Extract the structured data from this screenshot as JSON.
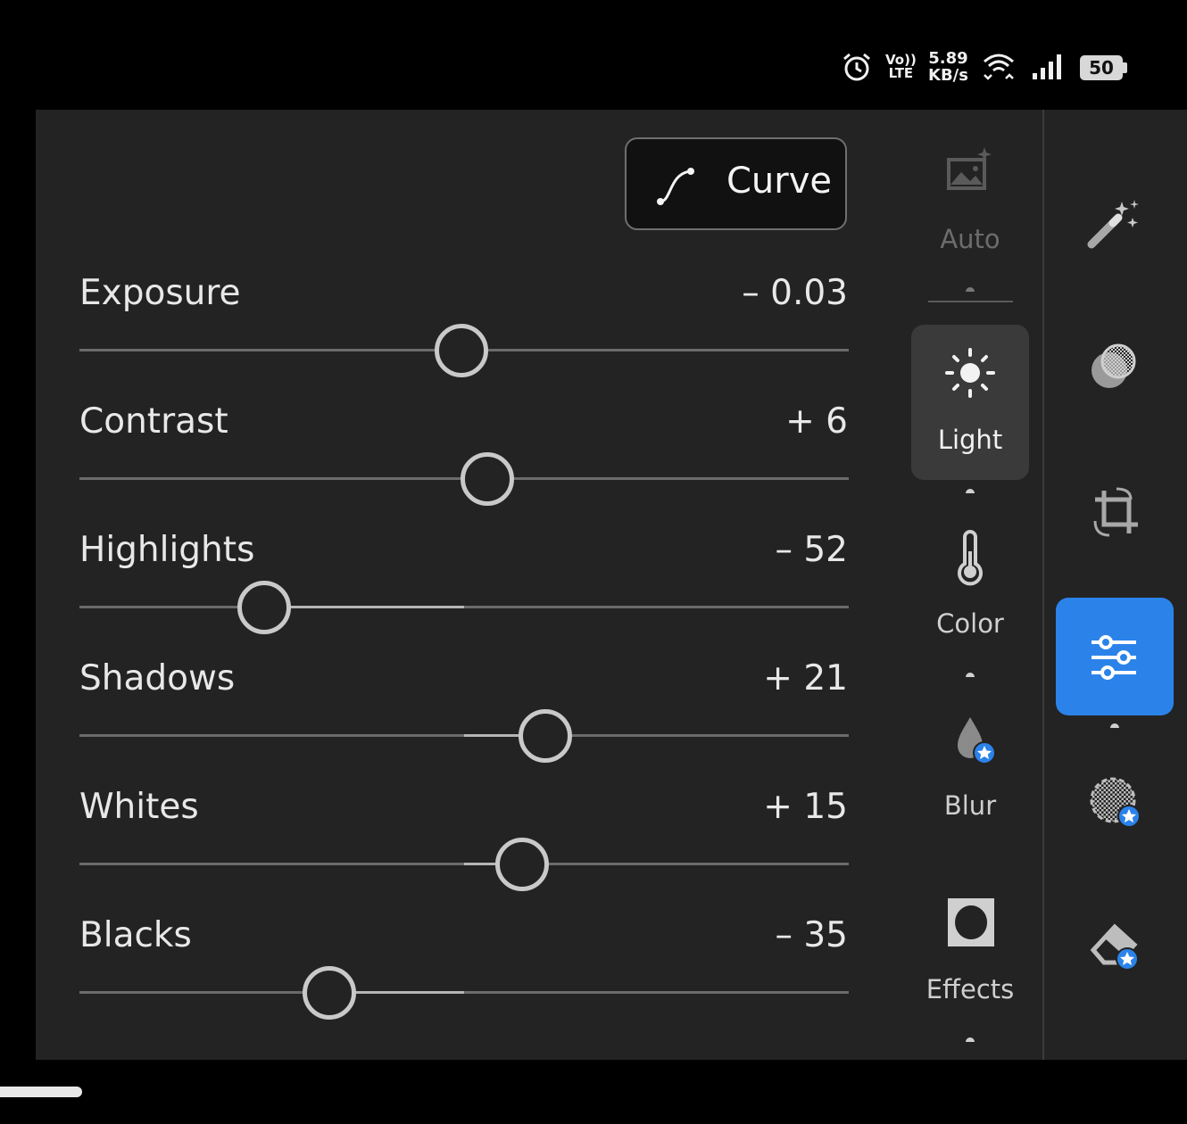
{
  "status_bar": {
    "alarm_icon": "alarm-clock-icon",
    "volte_top": "Vo))",
    "volte_bottom": "LTE",
    "speed_value": "5.89",
    "speed_unit": "KB/s",
    "battery": "50"
  },
  "curve_button": {
    "label": "Curve",
    "icon": "curve-icon"
  },
  "sliders": [
    {
      "label": "Exposure",
      "value": "– 0.03",
      "numeric": -0.03,
      "range": [
        -5,
        5
      ]
    },
    {
      "label": "Contrast",
      "value": "+ 6",
      "numeric": 6,
      "range": [
        -100,
        100
      ]
    },
    {
      "label": "Highlights",
      "value": "– 52",
      "numeric": -52,
      "range": [
        -100,
        100
      ]
    },
    {
      "label": "Shadows",
      "value": "+ 21",
      "numeric": 21,
      "range": [
        -100,
        100
      ]
    },
    {
      "label": "Whites",
      "value": "+ 15",
      "numeric": 15,
      "range": [
        -100,
        100
      ]
    },
    {
      "label": "Blacks",
      "value": "– 35",
      "numeric": -35,
      "range": [
        -100,
        100
      ]
    }
  ],
  "tools": [
    {
      "label": "Auto",
      "icon": "auto-image-icon",
      "active": false
    },
    {
      "label": "Light",
      "icon": "sun-icon",
      "active": true
    },
    {
      "label": "Color",
      "icon": "thermometer-icon",
      "active": false
    },
    {
      "label": "Blur",
      "icon": "drop-premium-icon",
      "active": false
    },
    {
      "label": "Effects",
      "icon": "vignette-icon",
      "active": false
    }
  ],
  "rail": [
    {
      "icon": "magic-wand-icon",
      "active": false
    },
    {
      "icon": "masking-icon",
      "active": false
    },
    {
      "icon": "crop-icon",
      "active": false
    },
    {
      "icon": "edit-sliders-icon",
      "active": true
    },
    {
      "icon": "healing-premium-icon",
      "active": false
    },
    {
      "icon": "eraser-premium-icon",
      "active": false
    }
  ],
  "colors": {
    "accent": "#2b83ea",
    "panel": "#232323",
    "knob": "#c9c9c9"
  }
}
